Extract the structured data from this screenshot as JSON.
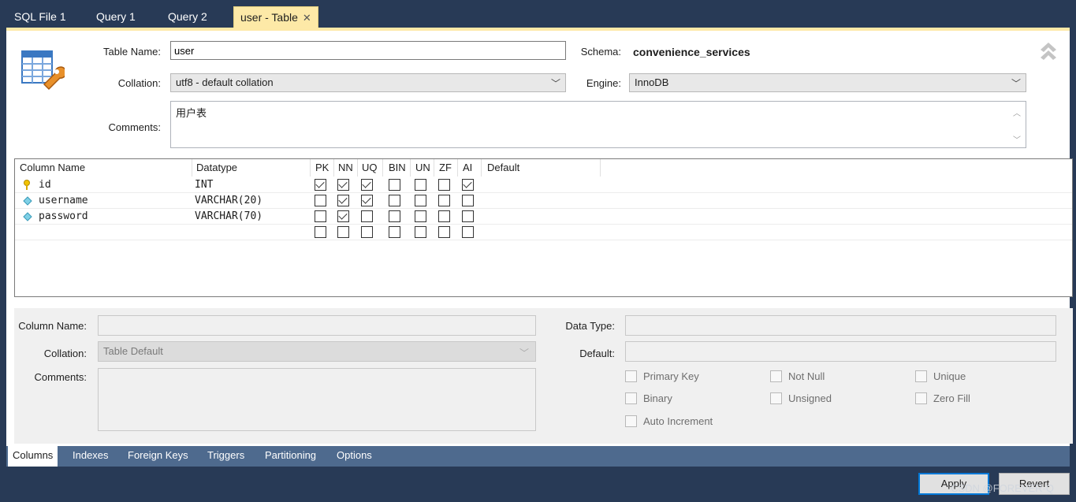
{
  "tabs": [
    {
      "label": "SQL File 1"
    },
    {
      "label": "Query 1"
    },
    {
      "label": "Query 2"
    },
    {
      "label": "user - Table",
      "close": "✕"
    }
  ],
  "form": {
    "table_name_label": "Table Name:",
    "table_name_value": "user",
    "schema_label": "Schema:",
    "schema_value": "convenience_services",
    "collation_label": "Collation:",
    "collation_value": "utf8 - default collation",
    "engine_label": "Engine:",
    "engine_value": "InnoDB",
    "comments_label": "Comments:",
    "comments_value": "用户表"
  },
  "grid": {
    "headers": {
      "column_name": "Column Name",
      "datatype": "Datatype",
      "pk": "PK",
      "nn": "NN",
      "uq": "UQ",
      "bin": "BIN",
      "un": "UN",
      "zf": "ZF",
      "ai": "AI",
      "default": "Default"
    },
    "rows": [
      {
        "name": "id",
        "type": "INT",
        "icon": "primary-key-icon",
        "pk": true,
        "nn": true,
        "uq": true,
        "bin": false,
        "un": false,
        "zf": false,
        "ai": true
      },
      {
        "name": "username",
        "type": "VARCHAR(20)",
        "icon": "column-diamond-icon",
        "pk": false,
        "nn": true,
        "uq": true,
        "bin": false,
        "un": false,
        "zf": false,
        "ai": false
      },
      {
        "name": "password",
        "type": "VARCHAR(70)",
        "icon": "column-diamond-icon",
        "pk": false,
        "nn": true,
        "uq": false,
        "bin": false,
        "un": false,
        "zf": false,
        "ai": false
      },
      {
        "name": "",
        "type": "",
        "icon": "",
        "pk": false,
        "nn": false,
        "uq": false,
        "bin": false,
        "un": false,
        "zf": false,
        "ai": false
      }
    ]
  },
  "detail": {
    "column_name_label": "Column Name:",
    "collation_label": "Collation:",
    "collation_value": "Table Default",
    "comments_label": "Comments:",
    "data_type_label": "Data Type:",
    "default_label": "Default:",
    "checks": {
      "primary_key": "Primary Key",
      "not_null": "Not Null",
      "unique": "Unique",
      "binary": "Binary",
      "unsigned": "Unsigned",
      "zero_fill": "Zero Fill",
      "auto_increment": "Auto Increment"
    }
  },
  "bottom_tabs": [
    {
      "label": "Columns"
    },
    {
      "label": "Indexes"
    },
    {
      "label": "Foreign Keys"
    },
    {
      "label": "Triggers"
    },
    {
      "label": "Partitioning"
    },
    {
      "label": "Options"
    }
  ],
  "footer": {
    "apply": "Apply",
    "revert": "Revert",
    "watermark": "CSDN @FOREVER-Q"
  },
  "colors": {
    "chrome": "#283a56",
    "active_tab": "#fde9a7",
    "bottom_bar": "#4e6a8e",
    "primary_border": "#0078d7"
  }
}
